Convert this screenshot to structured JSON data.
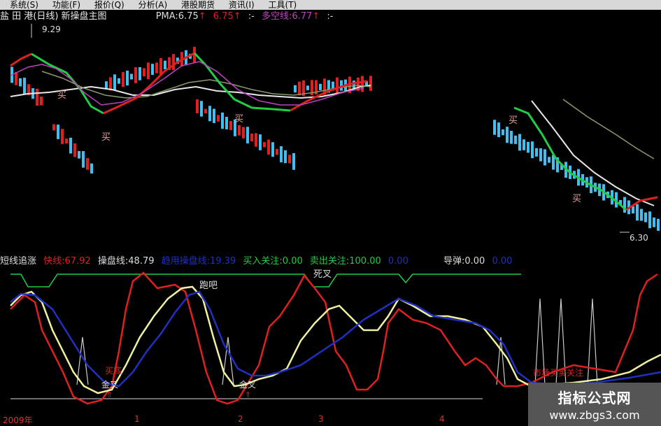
{
  "menu": [
    "系统(S)",
    "功能(F)",
    "报价(Q)",
    "分析(A)",
    "港股期货",
    "资讯(I)",
    "工具(T)"
  ],
  "title": {
    "stock": "盐 田 港(日线) 新操盘主图",
    "pma_label": "PMA:6.75",
    "pma2": "6.75",
    "duokong": "多空线:6.77",
    "sep": ":-",
    "arrow": "↑"
  },
  "annotations": {
    "high_price": "9.29",
    "low_price": "6.30",
    "buy": "买",
    "run": "跑吧",
    "death_cross": "死叉",
    "golden_cross": "金叉",
    "bottom_text_1": "买底",
    "bottom_text_2": "市场买卖关注"
  },
  "legend": {
    "name": "短线追涨",
    "fast": "快线:67.92",
    "op": "操盘线:48.79",
    "trend": "趋用操盘线:19.39",
    "buy_focus": "买入关注:0.00",
    "sell_focus": "卖出关注:100.00",
    "zero": "0.00",
    "missile": "导弹:0.00",
    "zero2": "0.00"
  },
  "xaxis": [
    "2009年",
    "1",
    "2",
    "3",
    "4"
  ],
  "watermark": {
    "title": "指标公式网",
    "url": "www.zbgs3.com"
  },
  "colors": {
    "red": "#e02020",
    "green": "#22cc44",
    "yellow": "#f0f0a0",
    "cyan": "#40c0f0",
    "blue": "#2030c0",
    "magenta": "#c040c0"
  }
}
